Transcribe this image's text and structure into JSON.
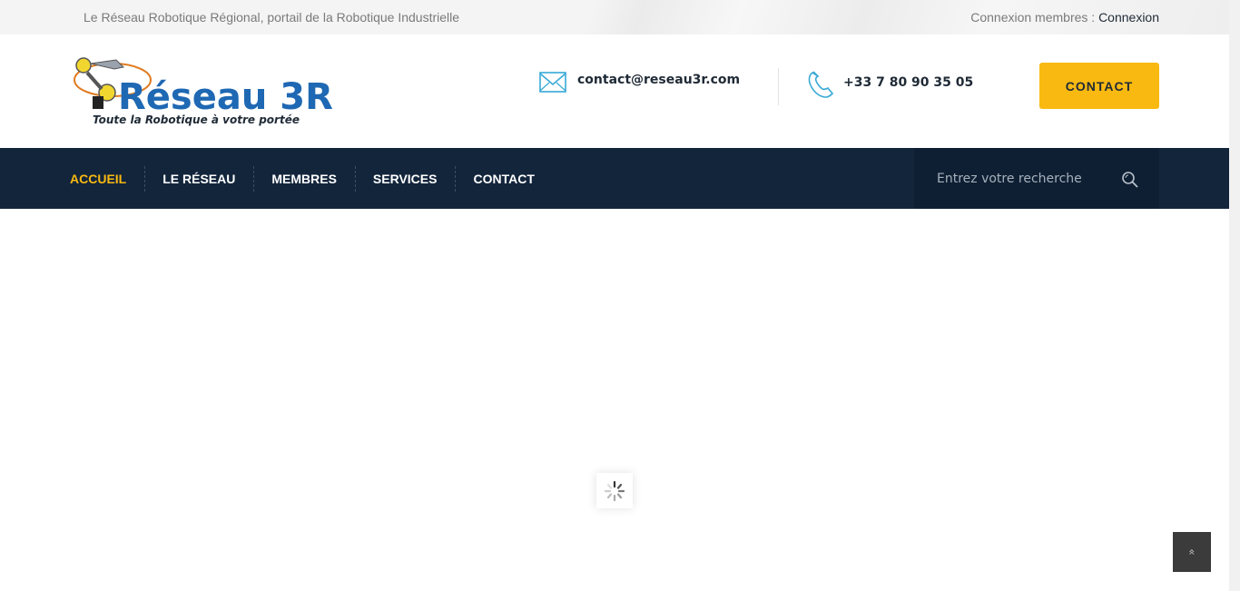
{
  "topbar": {
    "tagline": "Le Réseau Robotique Régional, portail de la Robotique Industrielle",
    "login_prefix": "Connexion membres : ",
    "login_link": "Connexion"
  },
  "header": {
    "logo_main": "Réseau 3R",
    "logo_subtitle": "Toute la Robotique à votre portée",
    "email": "contact@reseau3r.com",
    "phone": "+33 7 80 90 35 05",
    "contact_button": "CONTACT"
  },
  "nav": {
    "items": [
      {
        "label": "ACCUEIL",
        "active": true
      },
      {
        "label": "LE RÉSEAU",
        "active": false
      },
      {
        "label": "MEMBRES",
        "active": false
      },
      {
        "label": "SERVICES",
        "active": false
      },
      {
        "label": "CONTACT",
        "active": false
      }
    ],
    "search_placeholder": "Entrez votre recherche"
  },
  "colors": {
    "accent": "#f9b911",
    "nav_bg": "#13253b",
    "text_dark": "#1f2a36",
    "icon_blue": "#37a9d6"
  },
  "icons": {
    "email": "envelope-icon",
    "phone": "phone-icon",
    "search": "search-icon",
    "loader": "spinner-icon",
    "back_top": "double-chevron-up-icon"
  }
}
